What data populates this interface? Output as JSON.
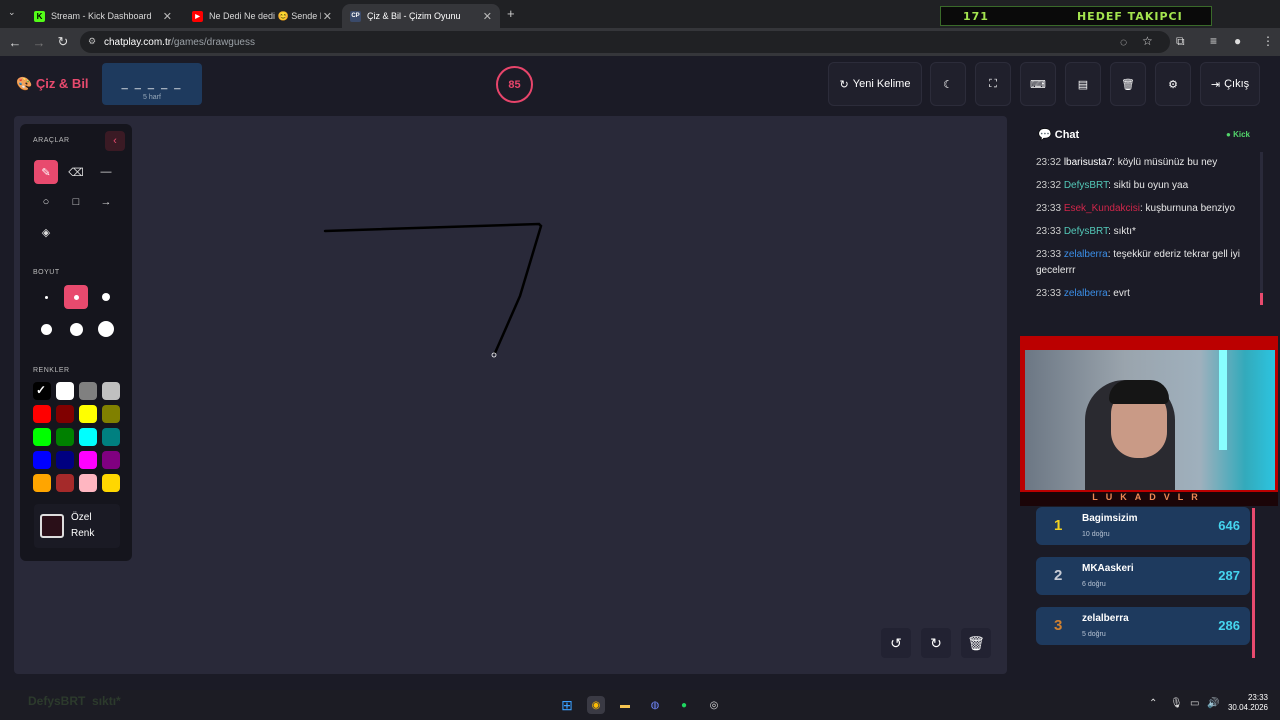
{
  "tabs": [
    {
      "label": "Stream - Kick Dashboard",
      "favicon": "K"
    },
    {
      "label": "Ne Dedi Ne dedi 😊 Sende Bur",
      "favicon": "▶"
    },
    {
      "label": "Çiz & Bil - Çizim Oyunu",
      "favicon": "CP"
    }
  ],
  "browser": {
    "url_host": "chatplay.com.tr",
    "url_path": "/games/drawguess"
  },
  "banner": {
    "count": "171",
    "text": "HEDEF TAKIPCI"
  },
  "app": {
    "logo": "Çiz & Bil",
    "word": {
      "blanks": "_ _ _ _ _",
      "hint": "5 harf"
    },
    "timer": "85",
    "buttons": {
      "new_word": "Yeni Kelime",
      "exit": "Çıkış"
    }
  },
  "tools": {
    "title": "ARAÇLAR",
    "size_title": "BOYUT",
    "color_title": "RENKLER",
    "custom_color": [
      "Özel",
      "Renk"
    ],
    "colors": [
      "#000000",
      "#ffffff",
      "#808080",
      "#c0c0c0",
      "#ff0000",
      "#800000",
      "#ffff00",
      "#808000",
      "#00ff00",
      "#008000",
      "#00ffff",
      "#008080",
      "#0000ff",
      "#000080",
      "#ff00ff",
      "#800080",
      "#ffa500",
      "#a52a2a",
      "#ffb6c1",
      "#ffd700"
    ],
    "selected_color": "#000000",
    "selected_size": 2
  },
  "chat": {
    "title": "Chat",
    "platform": "Kick",
    "messages": [
      {
        "time": "23:32",
        "user": "lbarisusta7",
        "color": "#ffffff",
        "text": ": köylü müsünüz bu ney"
      },
      {
        "time": "23:32",
        "user": "DefysBRT",
        "color": "#53c8b8",
        "text": ": sikti bu oyun yaa"
      },
      {
        "time": "23:33",
        "user": "Esek_Kundakcisi",
        "color": "#d0264a",
        "text": ": kuşburnuna benziyo"
      },
      {
        "time": "23:33",
        "user": "DefysBRT",
        "color": "#53c8b8",
        "text": ": sıktı*"
      },
      {
        "time": "23:33",
        "user": "zelalberra",
        "color": "#3b8ee6",
        "text": ": teşekkür ederiz tekrar gell iyi gecelerrr"
      },
      {
        "time": "23:33",
        "user": "zelalberra",
        "color": "#3b8ee6",
        "text": ": evrt"
      }
    ]
  },
  "webcam": {
    "name": "LUKADVLR"
  },
  "leaderboard": [
    {
      "rank": "1",
      "name": "Bagimsizim",
      "correct": "10 doğru",
      "points": "646",
      "rank_color": "#f0d020"
    },
    {
      "rank": "2",
      "name": "MKAaskeri",
      "correct": "6 doğru",
      "points": "287",
      "rank_color": "#c8ccd6"
    },
    {
      "rank": "3",
      "name": "zelalberra",
      "correct": "5 doğru",
      "points": "286",
      "rank_color": "#d08030"
    }
  ],
  "taskbar": {
    "ghost_user": "DefysBRT",
    "ghost_text": "sıktı*",
    "time": "23:33",
    "date": "30.04.2026"
  },
  "colors": {
    "accent": "#e84a6e",
    "panel": "#1e3a5e",
    "canvas": "#292939"
  }
}
